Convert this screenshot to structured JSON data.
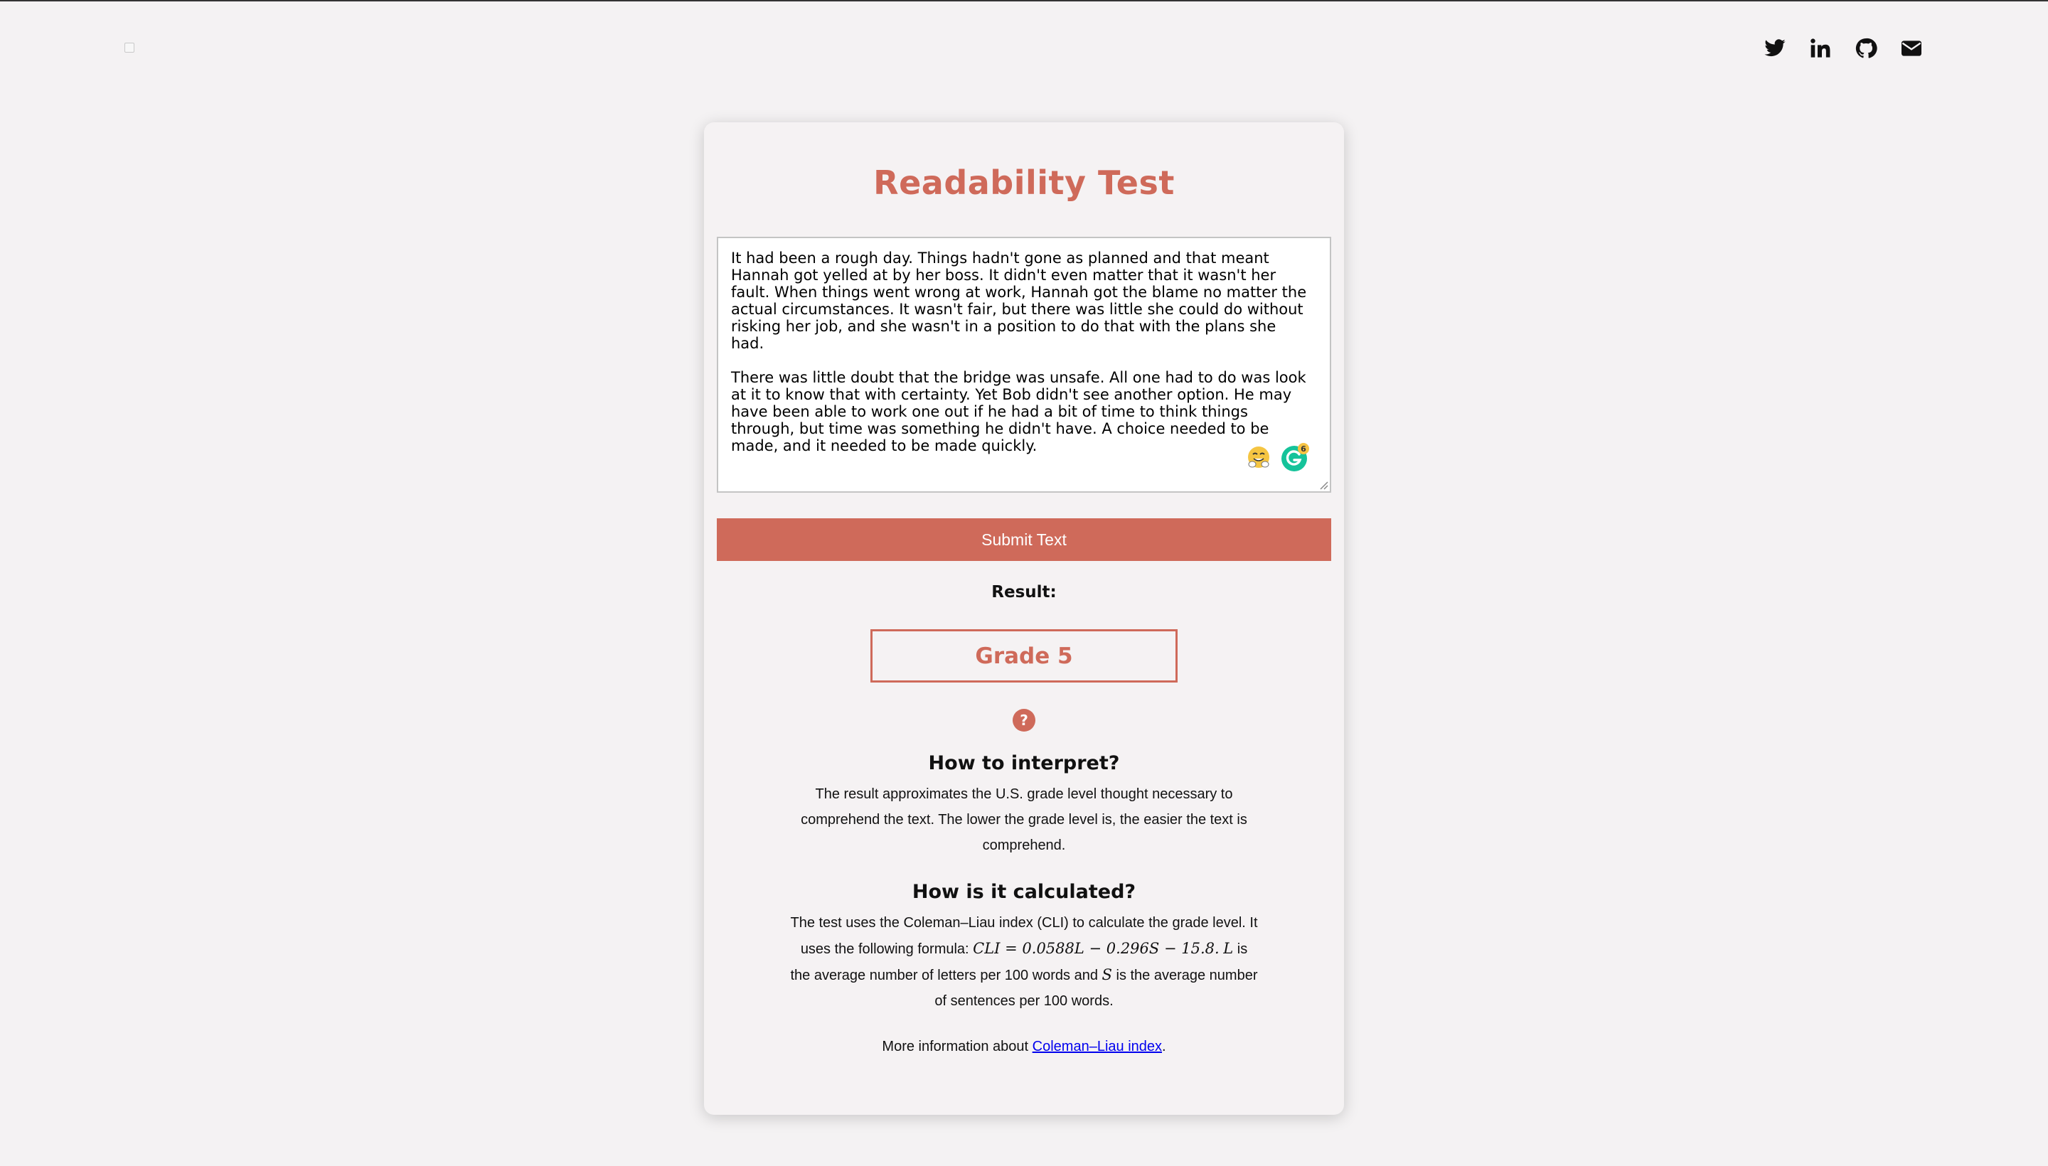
{
  "header": {
    "social_icons": [
      "twitter-icon",
      "linkedin-icon",
      "github-icon",
      "mail-icon"
    ]
  },
  "colors": {
    "accent": "#cf6a5a",
    "background": "#f4f2f3",
    "link": "#0000ee"
  },
  "app": {
    "title": "Readability Test"
  },
  "input": {
    "paragraphs": [
      "It had been a rough day. Things hadn't gone as planned and that meant Hannah got yelled at by her boss. It didn't even matter that it wasn't her fault. When things went wrong at work, Hannah got the blame no matter the actual circumstances. It wasn't fair, but there was little she could do without risking her job, and she wasn't in a position to do that with the plans she had.",
      "There was little doubt that the bridge was unsafe. All one had to do was look at it to know that with certainty. Yet Bob didn't see another option. He may have been able to work one out if he had a bit of time to think things through, but time was something he didn't have. A choice needed to be made, and it needed to be made quickly."
    ],
    "grammarly_badge": "6"
  },
  "submit_label": "Submit Text",
  "result": {
    "label": "Result:",
    "grade": "Grade 5",
    "help_glyph": "?"
  },
  "interpret": {
    "heading": "How to interpret?",
    "text": "The result approximates the U.S. grade level thought necessary to comprehend the text. The lower the grade level is, the easier the text is comprehend."
  },
  "calculated": {
    "heading": "How is it calculated?",
    "text_before": "The test uses the Coleman–Liau index (CLI) to calculate the grade level. It uses the following formula: ",
    "formula": "CLI = 0.0588L − 0.296S − 15.8.",
    "L_symbol": "L",
    "L_desc": " is the average number of letters per 100 words and ",
    "S_symbol": "S",
    "S_desc": " is the average number of sentences per 100 words."
  },
  "more_info": {
    "prefix": "More information about ",
    "link_text": "Coleman–Liau index",
    "suffix": "."
  }
}
